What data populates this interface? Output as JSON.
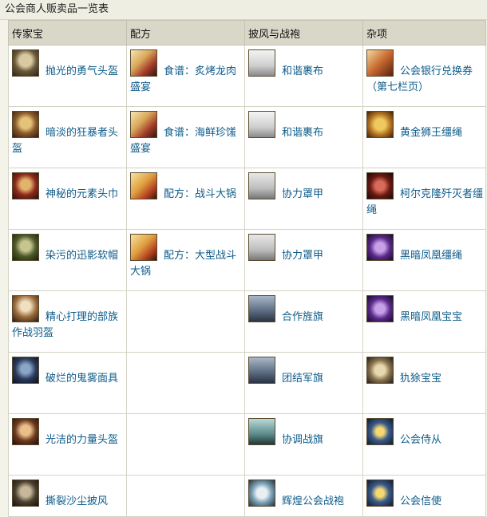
{
  "caption": "公会商人贩卖品一览表",
  "headers": [
    "传家宝",
    "配方",
    "披风与战袍",
    "杂项"
  ],
  "rows": [
    [
      {
        "icon": "helm-grey",
        "name": "抛光的勇气头盔"
      },
      {
        "icon": "scroll",
        "name": "食谱：炙烤龙肉盛宴"
      },
      {
        "icon": "cloth-white",
        "name": "和谐裹布"
      },
      {
        "icon": "voucher",
        "name": "公会银行兑换券（第七栏页）"
      }
    ],
    [
      {
        "icon": "helm-gold",
        "name": "暗淡的狂暴者头盔"
      },
      {
        "icon": "scroll",
        "name": "食谱：海鲜珍馐盛宴"
      },
      {
        "icon": "cloth-white",
        "name": "和谐裹布"
      },
      {
        "icon": "lion",
        "name": "黄金狮王缰绳"
      }
    ],
    [
      {
        "icon": "helm-red",
        "name": "神秘的元素头巾"
      },
      {
        "icon": "scroll2",
        "name": "配方：战斗大锅"
      },
      {
        "icon": "cloth-grey",
        "name": "协力罩甲"
      },
      {
        "icon": "raptor",
        "name": "柯尔克隆歼灭者缰绳"
      }
    ],
    [
      {
        "icon": "helm-green",
        "name": "染污的迅影软帽"
      },
      {
        "icon": "scroll2",
        "name": "配方：大型战斗大锅"
      },
      {
        "icon": "cloth-grey",
        "name": "协力罩甲"
      },
      {
        "icon": "phoenix",
        "name": "黑暗凤凰缰绳"
      }
    ],
    [
      {
        "icon": "helm-plume",
        "name": "精心打理的部族作战羽盔"
      },
      null,
      {
        "icon": "banner-blue",
        "name": "合作旌旗"
      },
      {
        "icon": "phoenix",
        "name": "黑暗凤凰宝宝"
      }
    ],
    [
      {
        "icon": "mask-blue",
        "name": "破烂的鬼雾面具"
      },
      null,
      {
        "icon": "banner-blue",
        "name": "团结军旗"
      },
      {
        "icon": "armadillo",
        "name": "犰狳宝宝"
      }
    ],
    [
      {
        "icon": "helm-bronze",
        "name": "光洁的力量头盔"
      },
      null,
      {
        "icon": "banner-teal",
        "name": "协调战旗"
      },
      {
        "icon": "star",
        "name": "公会侍从"
      }
    ],
    [
      {
        "icon": "cloak-dark",
        "name": "撕裂沙尘披风"
      },
      null,
      {
        "icon": "crest",
        "name": "辉煌公会战袍"
      },
      {
        "icon": "star",
        "name": "公会信使"
      }
    ]
  ]
}
